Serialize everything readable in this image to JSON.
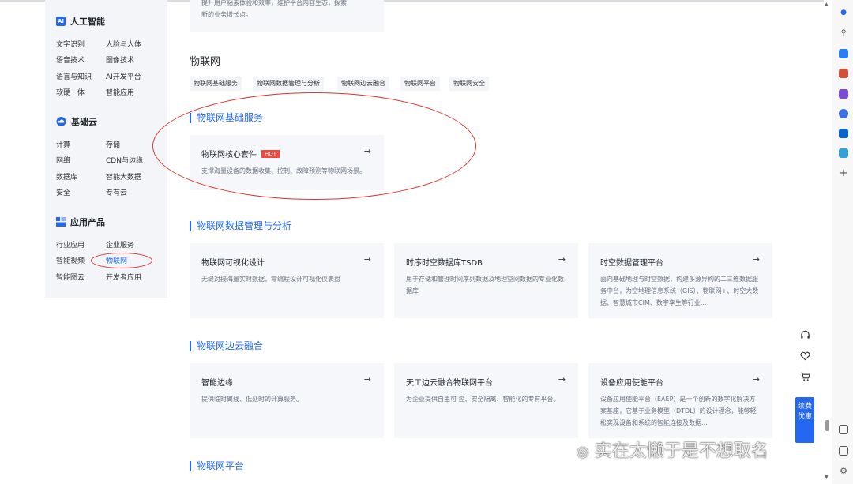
{
  "sidebar": {
    "groups": [
      {
        "title": "人工智能",
        "items": [
          "文字识别",
          "人脸与人体",
          "语音技术",
          "图像技术",
          "语言与知识",
          "AI开发平台",
          "软硬一体",
          "智能应用"
        ]
      },
      {
        "title": "基础云",
        "items": [
          "计算",
          "存储",
          "网络",
          "CDN与边缘",
          "数据库",
          "智能大数据",
          "安全",
          "专有云"
        ]
      },
      {
        "title": "应用产品",
        "items": [
          "行业应用",
          "企业服务",
          "智能视频",
          "物联网",
          "智能图云",
          "开发者应用"
        ]
      }
    ],
    "ai_icon_text": "AI"
  },
  "main": {
    "top_card_desc": [
      "提升用户粘素体验和效率，维护平台内容生态，探索",
      "新的业务增长点。"
    ],
    "heading": "物联网",
    "tags": [
      "物联网基础服务",
      "物联网数据管理与分析",
      "物联网边云融合",
      "物联网平台",
      "物联网安全"
    ],
    "sections": [
      {
        "title": "物联网基础服务",
        "cards": [
          {
            "title": "物联网核心套件",
            "badge": "HOT",
            "desc": "支撑海量设备的数据收集、控制、故障预测等物联网场景。"
          }
        ]
      },
      {
        "title": "物联网数据管理与分析",
        "cards": [
          {
            "title": "物联网可视化设计",
            "desc": "无缝对接海量实时数据，零编程设计可视化仪表盘"
          },
          {
            "title": "时序时空数据库TSDB",
            "desc": "用于存储和管理时间序列数据及地理空间数据的专业化数据库"
          },
          {
            "title": "时空数据管理平台",
            "desc": "面向基础地理与时空数据，构建多源异构的二三维数据服务中台，为空地理信息系统（GIS）、物联网+、时空大数据、智慧城市CIM、数字孪生等行业..."
          }
        ]
      },
      {
        "title": "物联网边云融合",
        "cards": [
          {
            "title": "智能边缘",
            "desc": "提供临时离线、低延时的计算服务。"
          },
          {
            "title": "天工边云融合物联网平台",
            "desc": "为企业提供自主可 控、安全隔离、智能化的专有平台。"
          },
          {
            "title": "设备应用使能平台",
            "desc": "设备应用使能平台（EAEP）是一个创新的数字化解决方案基座，它基于业务模型（DTDL）的设计理念，能够轻松实现设备和系统的智能连接及数据..."
          }
        ]
      },
      {
        "title": "物联网平台",
        "cards": []
      }
    ],
    "arrow": "→"
  },
  "float": {
    "promo": "续费优惠"
  },
  "watermark": "实在太懒于是不想取名",
  "icons": [
    "bell-icon",
    "search-icon",
    "tag-icon",
    "toolbox-icon",
    "chess-icon",
    "copilot-icon",
    "outlook-icon",
    "send-icon",
    "plus-icon",
    "headset-icon",
    "heart-icon",
    "cart-icon",
    "wechat-icon"
  ],
  "colors": {
    "accent": "#2468f2",
    "hot": "#f0483e",
    "annotation": "#e0312a",
    "card_bg": "#f5f7fa"
  }
}
